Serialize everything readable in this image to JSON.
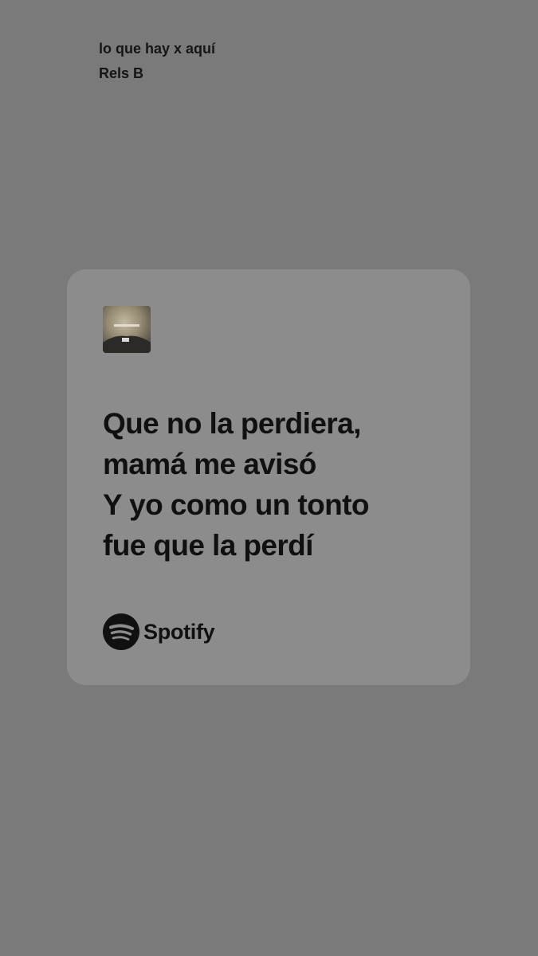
{
  "colors": {
    "background": "#7a7a7a",
    "card": "#8c8c8c",
    "text": "#101010"
  },
  "track": {
    "title": "lo que hay x aquí",
    "artist": "Rels B",
    "cover_icon": "album-cover-image"
  },
  "lyrics": [
    "Que no la perdiera,",
    "mamá me avisó",
    "Y yo como un tonto",
    "fue que la perdí"
  ],
  "brand": {
    "icon": "spotify-logo-icon",
    "name": "Spotify"
  }
}
